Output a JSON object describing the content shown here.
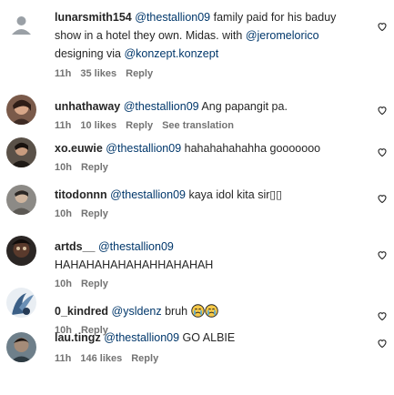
{
  "comments": [
    {
      "username": "lunarsmith154",
      "mention": "@thestallion09",
      "text1": " family paid for his baduy show in a hotel they own. Midas. with ",
      "mention2": "@jeromelorico",
      "text2": " designing via ",
      "mention3": "@konzept.konzept",
      "time": "11h",
      "likes": "35 likes",
      "reply": "Reply"
    },
    {
      "username": "unhathaway",
      "mention": "@thestallion09",
      "text1": " Ang papangit pa.",
      "time": "11h",
      "likes": "10 likes",
      "reply": "Reply",
      "translate": "See translation"
    },
    {
      "username": "xo.euwie",
      "mention": "@thestallion09",
      "text1": " hahahahahahha gooooooo",
      "time": "10h",
      "reply": "Reply"
    },
    {
      "username": "titodonnn",
      "mention": "@thestallion09",
      "text1": " kaya idol kita sir▯▯",
      "time": "10h",
      "reply": "Reply"
    },
    {
      "username": "artds__",
      "mention": "@thestallion09",
      "text1": "HAHAHAHAHAHAHHAHAHAH",
      "time": "10h",
      "reply": "Reply"
    },
    {
      "username": "0_kindred",
      "mention": "@ysldenz",
      "text1": " bruh ",
      "time": "10h",
      "reply": "Reply"
    },
    {
      "username": "lau.tingz",
      "mention": "@thestallion09",
      "text1": " GO ALBIE",
      "time": "11h",
      "likes": "146 likes",
      "reply": "Reply"
    }
  ],
  "colors": {
    "text": "#262626",
    "mention": "#00376b",
    "meta": "#737373"
  },
  "icons": {
    "like": "heart-outline-icon",
    "emoji": "crying-face-emoji"
  }
}
